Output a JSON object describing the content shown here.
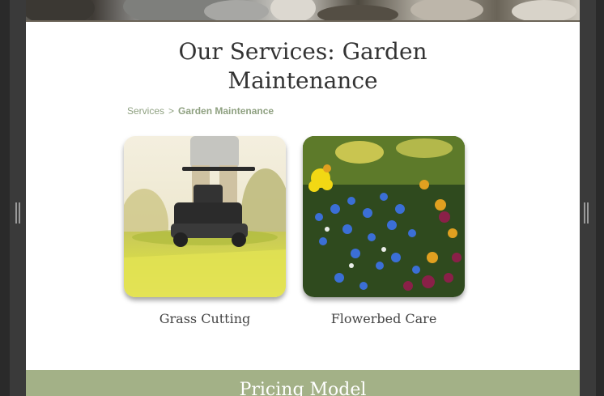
{
  "page": {
    "title_line1": "Our Services: Garden",
    "title_line2": "Maintenance"
  },
  "breadcrumb": {
    "parent": "Services",
    "separator": ">",
    "current": "Garden Maintenance"
  },
  "services": [
    {
      "label": "Grass Cutting"
    },
    {
      "label": "Flowerbed Care"
    }
  ],
  "pricing": {
    "title": "Pricing Model"
  },
  "colors": {
    "accent": "#a3b187",
    "breadcrumb": "#8fa181",
    "title_text": "#333333"
  }
}
